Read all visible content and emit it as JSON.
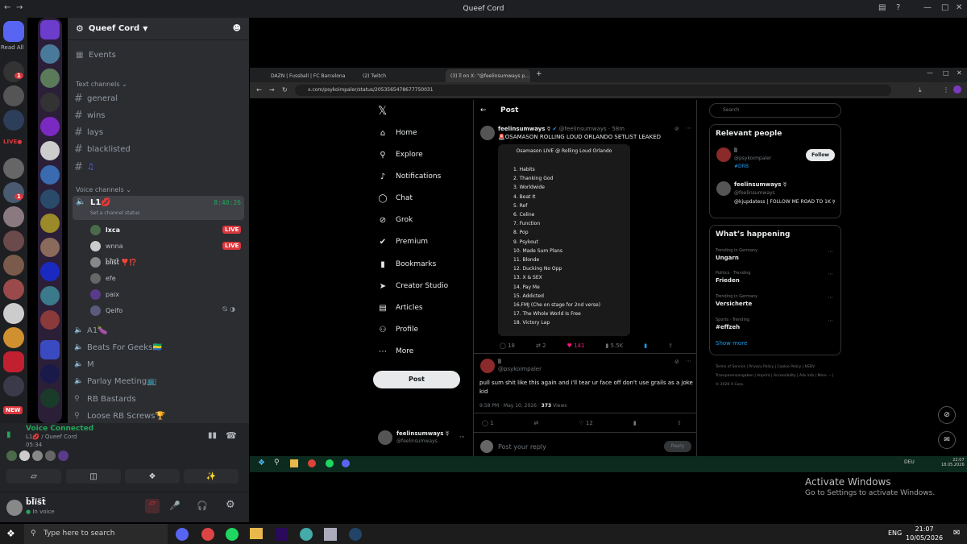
{
  "app": {
    "title": "Queef Cord"
  },
  "servers": {
    "read_all": "Read All",
    "badge1": "1",
    "badge2": "1",
    "live_label": "LIVE●",
    "new_label": "NEW"
  },
  "channels": {
    "guild_name": "Queef Cord",
    "events": "Events",
    "text_header": "Text channels",
    "text": [
      "general",
      "wins",
      "lays",
      "blacklisted",
      "♫"
    ],
    "voice_header": "Voice channels",
    "active_voice": {
      "name": "L1💋",
      "time": "8:40:26",
      "status": "Set a channel status"
    },
    "users": [
      {
        "name": "lxca",
        "live": "LIVE"
      },
      {
        "name": "wnna",
        "live": "LIVE"
      },
      {
        "name": "b̃l̃ĩs̃t̃ ❣️⁉️"
      },
      {
        "name": "efe"
      },
      {
        "name": "paix"
      },
      {
        "name": "Qeifo"
      }
    ],
    "voice": [
      "A1🍆",
      "Beats For Geeks🇬🇦",
      "M",
      "Parlay Meeting📺",
      "RB Bastards",
      "Loose RB Screws🏆"
    ]
  },
  "voice_bar": {
    "status": "Voice Connected",
    "channel": "L1💋 / Queef Cord",
    "time": "05:34"
  },
  "user_bar": {
    "name": "b̃l̃ĩs̃t̃",
    "status": "In voice"
  },
  "browser": {
    "tabs": [
      "DAZN | Fussball | FC Barcelona",
      "(2) Twitch",
      "(3) ĩl on X: \"@feelinsumways p..."
    ],
    "url": "x.com/psykoimpaler/status/2053565478677750031"
  },
  "x_nav": [
    "Home",
    "Explore",
    "Notifications",
    "Chat",
    "Grok",
    "Premium",
    "Bookmarks",
    "Creator Studio",
    "Articles",
    "Profile",
    "More"
  ],
  "x_post_button": "Post",
  "post_header": "Post",
  "tweet1": {
    "name": "feelinsumways ☿",
    "handle": "@feelinsumways · 58m",
    "text": "🚨OSAMASON ROLLING LOUD ORLANDO SETLIST LEAKED",
    "setlist_title": "Osamason LIVE @ Rolling Loud Orlando",
    "setlist": [
      "1. Habits",
      "2. Thanking God",
      "3. Worldwide",
      "4. Beat It",
      "5. Ref",
      "6. Celine",
      "7. Function",
      "8. Pop",
      "9. Psykout",
      "10. Made Sum Plans",
      "11. Blonde",
      "12. Ducking No Opp",
      "13. X & SEX",
      "14. Pay Me",
      "15. Addicted",
      "16.FMJ (Che on stage for 2nd verse)",
      "17. The Whole World Is Free",
      "18. Victory Lap"
    ],
    "replies": "18",
    "retweets": "2",
    "likes": "141",
    "views": "5.5K"
  },
  "tweet2": {
    "name": "ĩl",
    "handle": "@psykoimpaler",
    "text": "pull sum shit like this again and i'll tear ur face off don't use grails as a joke kid",
    "meta": "9:58 PM · May 10, 2026 · ",
    "views": "373",
    "views_label": "Views",
    "replies": "1",
    "likes": "12"
  },
  "tweet3": {
    "name": "feelinsumways ☿",
    "handle": "@feelinsumways"
  },
  "reply_box": {
    "placeholder": "Post your reply",
    "button": "Reply"
  },
  "sidebar": {
    "search_placeholder": "Search",
    "relevant_title": "Relevant people",
    "people": [
      {
        "name": "ĩl",
        "handle": "@psykoimpaler",
        "bio": "#DRB",
        "button": "Follow"
      },
      {
        "name": "feelinsumways ☿",
        "handle": "@feelinsumways",
        "bio": "@kjupdatess | FOLLOW ME ROAD TO 1K ☿"
      }
    ],
    "happening_title": "What’s happening",
    "trends": [
      {
        "context": "Trending in Germany",
        "name": "Ungarn"
      },
      {
        "context": "Politics · Trending",
        "name": "Frieden"
      },
      {
        "context": "Trending in Germany",
        "name": "Versicherte"
      },
      {
        "context": "Sports · Trending",
        "name": "#effzeh"
      }
    ],
    "show_more": "Show more",
    "footer": "Terms of Service | Privacy Policy | Cookie Policy | NSDV Transparenzangaben | Imprint | Accessibility | Ads info | More ··· | © 2026 X Corp."
  },
  "inner_taskbar": {
    "lang": "DEU",
    "time": "22:07",
    "date": "18.05.2026"
  },
  "activate": {
    "title": "Activate Windows",
    "subtitle": "Go to Settings to activate Windows."
  },
  "taskbar": {
    "search": "Type here to search",
    "lang": "ENG",
    "time": "21:07",
    "date": "10/05/2026"
  },
  "colors": {
    "discord_bg": "#2b2d31",
    "live_red": "#da373c",
    "voice_green": "#23a55a",
    "x_blue": "#1d9bf0",
    "like_pink": "#f91880"
  }
}
